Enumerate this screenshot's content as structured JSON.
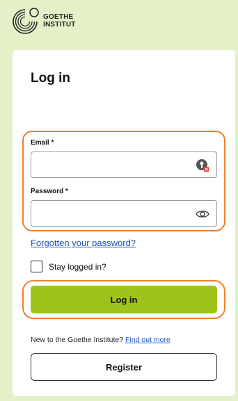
{
  "brand": {
    "line1": "GOETHE",
    "line2": "INSTITUT"
  },
  "form": {
    "title": "Log in",
    "email_label": "Email *",
    "email_value": "",
    "password_label": "Password *",
    "password_value": "",
    "forgot_link": "Forgotten your password?",
    "stay_logged_in": "Stay logged in?",
    "stay_logged_in_checked": false,
    "login_button": "Log in",
    "new_prompt": "New to the Goethe Institute?",
    "find_out_more": "Find out more",
    "register_button": "Register"
  },
  "icons": {
    "email_field": "password-manager-icon",
    "password_field": "eye-icon"
  },
  "colors": {
    "background": "#e3f0c8",
    "primary_button": "#a0c31c",
    "link": "#1c52b5",
    "highlight": "#f07f2a"
  }
}
